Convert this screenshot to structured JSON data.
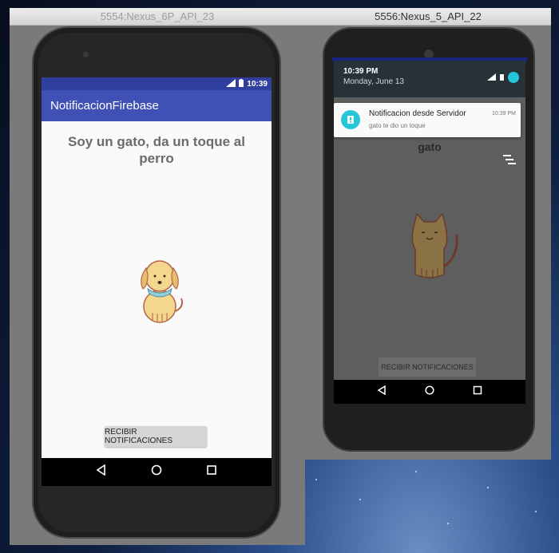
{
  "emulator1": {
    "window_title": "5554:Nexus_6P_API_23",
    "status_time": "10:39",
    "app_title": "NotificacionFirebase",
    "heading": "Soy un gato, da un toque al perro",
    "image_icon": "dog-icon",
    "button_label": "RECIBIR NOTIFICACIONES"
  },
  "emulator2": {
    "window_title": "5556:Nexus_5_API_22",
    "shade_time": "10:39 PM",
    "shade_date": "Monday, June 13",
    "notification": {
      "title": "Notificacion desde Servidor",
      "text": "gato te dio un toque",
      "time": "10:39 PM"
    },
    "heading": "gato",
    "image_icon": "cat-icon",
    "button_label": "RECIBIR NOTIFICACIONES"
  },
  "colors": {
    "primary": "#3f51b5",
    "primary_dark": "#303f9f",
    "notification_accent": "#26c6da"
  }
}
